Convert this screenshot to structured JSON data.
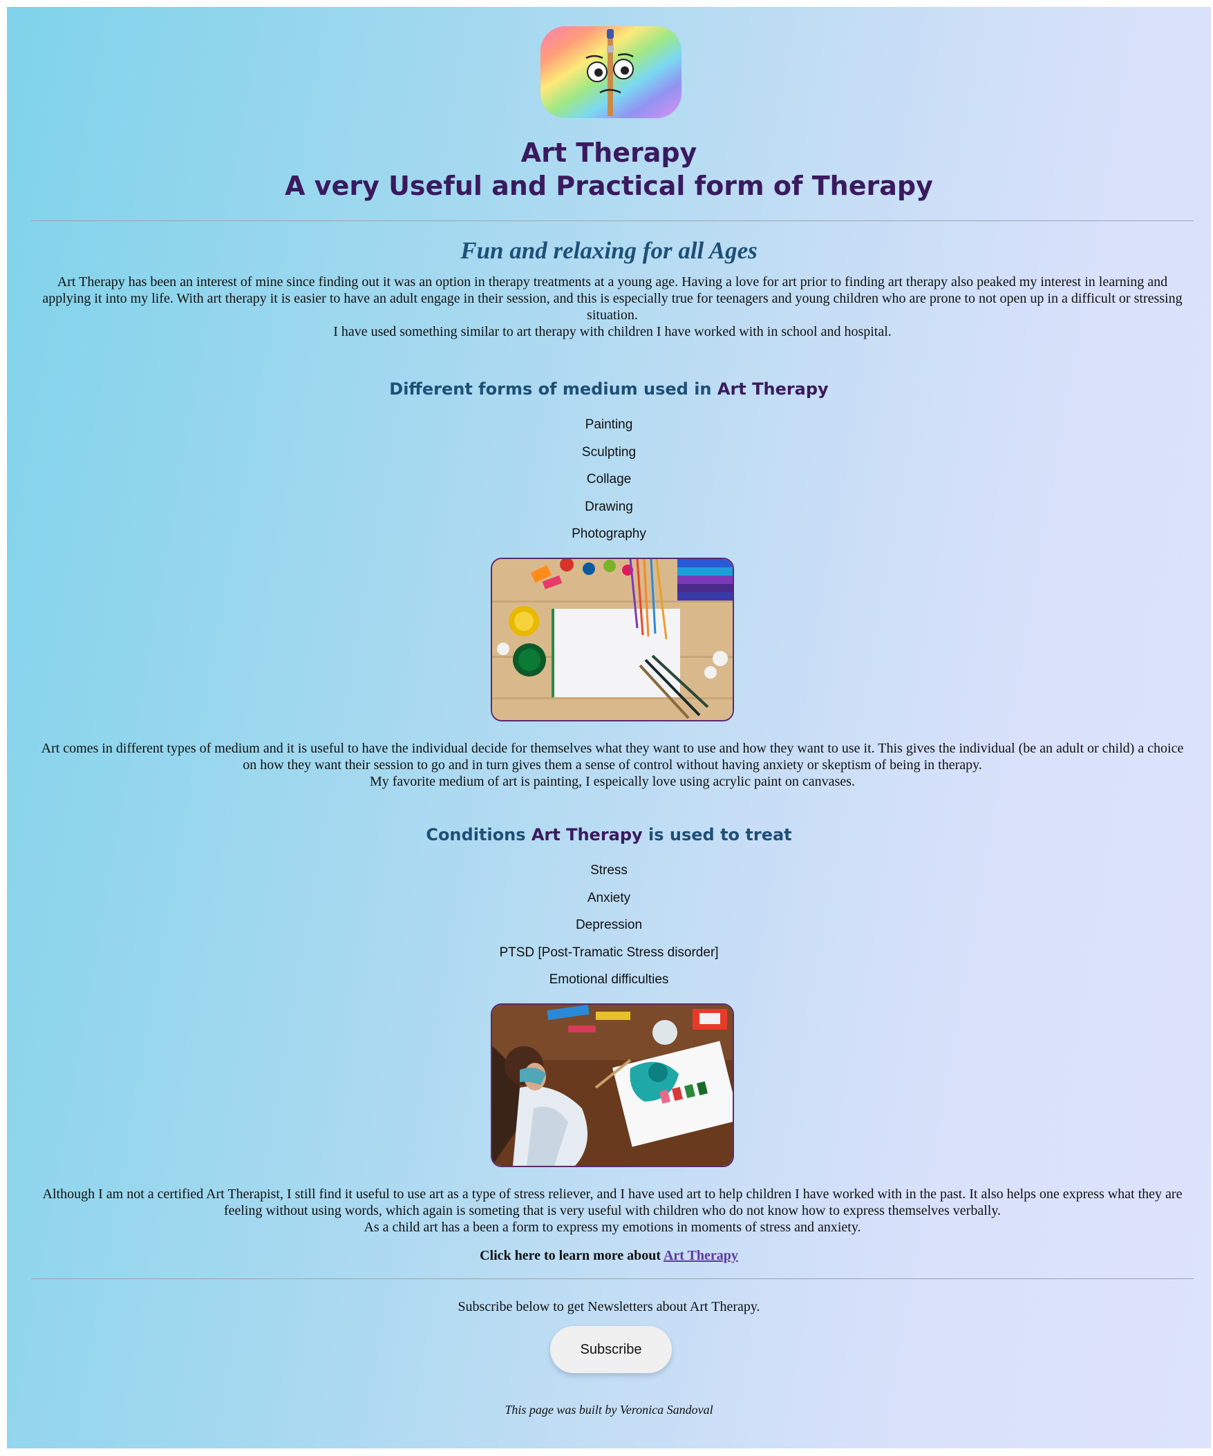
{
  "header": {
    "logo_icon": "rainbow-paintbrush-face-logo",
    "title": "Art Therapy",
    "subtitle": "A very Useful and Practical form of Therapy"
  },
  "intro": {
    "heading": "Fun and relaxing for all Ages",
    "paragraph": "Art Therapy has been an interest of mine since finding out it was an option in therapy treatments at a young age. Having a love for art prior to finding art therapy also peaked my interest in learning and applying it into my life. With art therapy it is easier to have an adult engage in their session, and this is especially true for teenagers and young children who are prone to not open up in a difficult or stressing situation.",
    "paragraph2": "I have used something similar to art therapy with children I have worked with in school and hospital."
  },
  "mediums": {
    "heading_prefix": "Different forms of medium used in ",
    "heading_accent": "Art Therapy",
    "items": [
      "Painting",
      "Sculpting",
      "Collage",
      "Drawing",
      "Photography"
    ],
    "image_icon": "art-supplies-photo",
    "paragraph": "Art comes in different types of medium and it is useful to have the individual decide for themselves what they want to use and how they want to use it. This gives the individual (be an adult or child) a choice on how they want their session to go and in turn gives them a sense of control without having anxiety or skeptism of being in therapy.",
    "paragraph2": "My favorite medium of art is painting, I espeically love using acrylic paint on canvases."
  },
  "conditions": {
    "heading_prefix": "Conditions ",
    "heading_accent": "Art Therapy",
    "heading_suffix": " is used to treat",
    "items": [
      "Stress",
      "Anxiety",
      "Depression",
      "PTSD [Post-Tramatic Stress disorder]",
      "Emotional difficulties"
    ],
    "image_icon": "child-painting-photo",
    "paragraph": "Although I am not a certified Art Therapist, I still find it useful to use art as a type of stress reliever, and I have used art to help children I have worked with in the past. It also helps one express what they are feeling without using words, which again is someting that is very useful with children who do not know how to express themselves verbally.",
    "paragraph2": "As a child art has a been a form to express my emotions in moments of stress and anxiety."
  },
  "learn_more": {
    "prefix": "Click here to learn more about ",
    "link": "Art Therapy"
  },
  "newsletter": {
    "text": "Subscribe below to get Newsletters about Art Therapy.",
    "button": "Subscribe"
  },
  "footer": {
    "credit": "This page was built by Veronica Sandoval"
  },
  "colors": {
    "title": "#3a1a5e",
    "heading": "#1e4f76",
    "link": "#5a3a9e",
    "image_border": "#5b2a6e"
  }
}
